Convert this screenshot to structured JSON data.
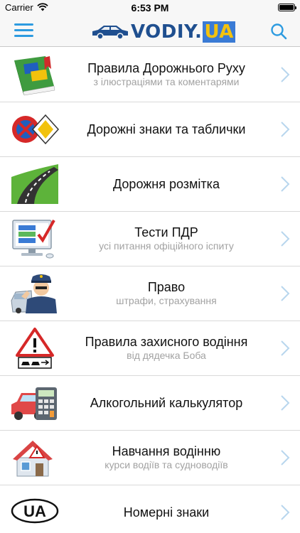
{
  "status_bar": {
    "carrier": "Carrier",
    "time": "6:53 PM"
  },
  "navbar": {
    "logo_text": "VODIY",
    "logo_dot": ".",
    "logo_ua": "UA"
  },
  "menu": [
    {
      "title": "Правила Дорожнього Руху",
      "subtitle": "з ілюстраціями та коментарями",
      "icon": "rulebook-icon"
    },
    {
      "title": "Дорожні знаки та таблички",
      "subtitle": "",
      "icon": "road-signs-icon"
    },
    {
      "title": "Дорожня розмітка",
      "subtitle": "",
      "icon": "road-marking-icon"
    },
    {
      "title": "Тести ПДР",
      "subtitle": "усі питання офіційного іспиту",
      "icon": "tests-monitor-icon"
    },
    {
      "title": "Право",
      "subtitle": "штрафи, страхування",
      "icon": "police-officer-icon"
    },
    {
      "title": "Правила захисного водіння",
      "subtitle": "від дядечка Боба",
      "icon": "warning-sign-icon"
    },
    {
      "title": "Алкогольний калькулятор",
      "subtitle": "",
      "icon": "car-calculator-icon"
    },
    {
      "title": "Навчання водінню",
      "subtitle": "курси водіїв та судноводіїв",
      "icon": "driving-school-icon"
    },
    {
      "title": "Номерні знаки",
      "subtitle": "",
      "icon": "ua-plate-icon"
    }
  ],
  "colors": {
    "accent": "#2d9be0",
    "chevron": "#b8d6ee",
    "separator": "#d9d9d9"
  }
}
